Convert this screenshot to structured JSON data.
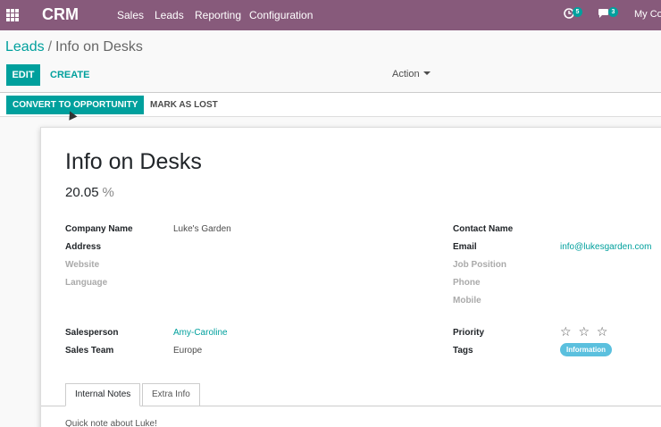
{
  "topbar": {
    "brand": "CRM",
    "menu": [
      "Sales",
      "Leads",
      "Reporting",
      "Configuration"
    ],
    "activity_count": "5",
    "message_count": "3",
    "company": "My Co"
  },
  "breadcrumb": {
    "parent": "Leads",
    "separator": "/",
    "current": "Info on Desks"
  },
  "controls": {
    "edit": "EDIT",
    "create": "CREATE",
    "action": "Action"
  },
  "statusbar": {
    "convert": "CONVERT TO OPPORTUNITY",
    "lost": "MARK AS LOST"
  },
  "form": {
    "title": "Info on Desks",
    "probability": "20.05",
    "probability_unit": "%",
    "company_name_label": "Company Name",
    "company_name": "Luke's Garden",
    "address_label": "Address",
    "website_label": "Website",
    "language_label": "Language",
    "contact_name_label": "Contact Name",
    "email_label": "Email",
    "email": "info@lukesgarden.com",
    "job_position_label": "Job Position",
    "phone_label": "Phone",
    "mobile_label": "Mobile",
    "salesperson_label": "Salesperson",
    "salesperson": "Amy-Caroline",
    "sales_team_label": "Sales Team",
    "sales_team": "Europe",
    "priority_label": "Priority",
    "priority_stars": "☆ ☆ ☆",
    "tags_label": "Tags",
    "tag": "Information"
  },
  "tabs": [
    "Internal Notes",
    "Extra Info"
  ],
  "note": "Quick note about Luke!",
  "colors": {
    "topbar": "#875a7b",
    "accent": "#00a09d",
    "tag": "#5bc0de"
  }
}
